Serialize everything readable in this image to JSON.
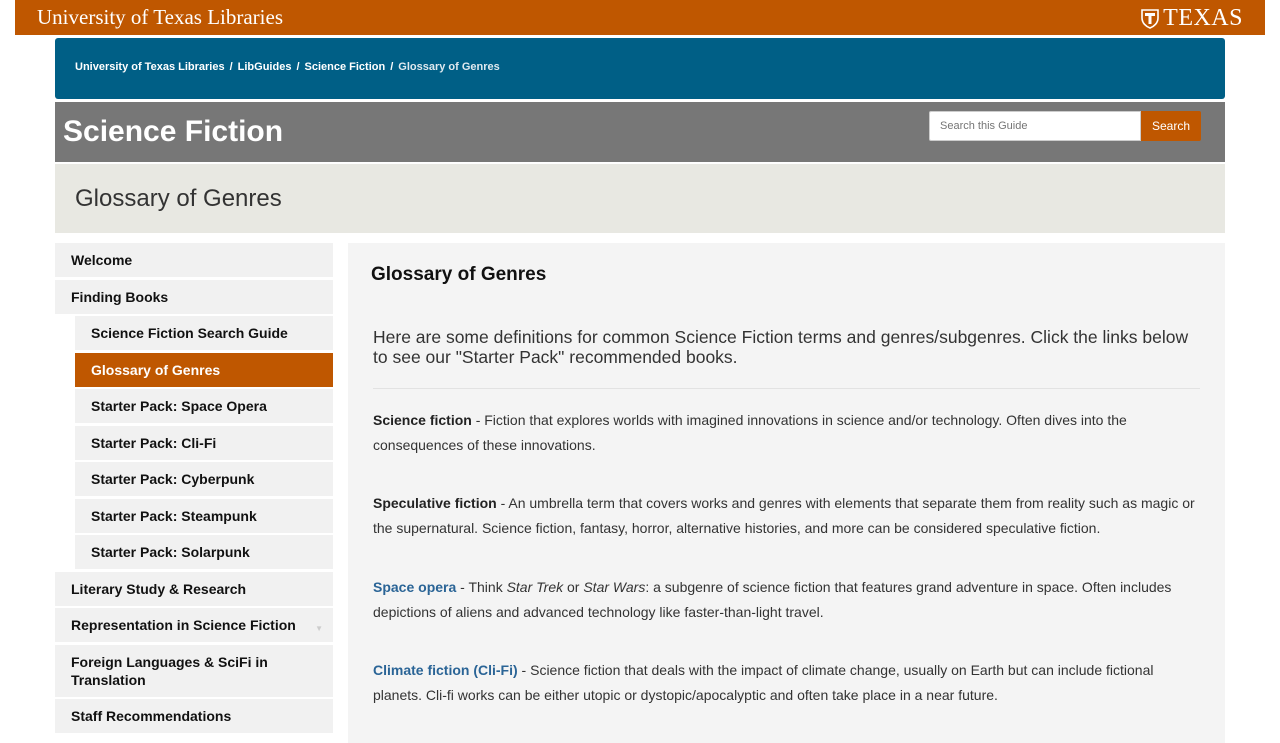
{
  "header": {
    "brand": "University of Texas Libraries",
    "texas": "TEXAS"
  },
  "breadcrumb": {
    "items": [
      "University of Texas Libraries",
      "LibGuides",
      "Science Fiction"
    ],
    "current": "Glossary of Genres",
    "separator": "/"
  },
  "guide": {
    "title": "Science Fiction",
    "search_placeholder": "Search this Guide",
    "search_button": "Search"
  },
  "page": {
    "title": "Glossary of Genres"
  },
  "sidebar": {
    "items": [
      {
        "label": "Welcome"
      },
      {
        "label": "Finding Books"
      },
      {
        "label": "Science Fiction Search Guide"
      },
      {
        "label": "Glossary of Genres"
      },
      {
        "label": "Starter Pack: Space Opera"
      },
      {
        "label": "Starter Pack: Cli-Fi"
      },
      {
        "label": "Starter Pack: Cyberpunk"
      },
      {
        "label": "Starter Pack: Steampunk"
      },
      {
        "label": "Starter Pack: Solarpunk"
      },
      {
        "label": "Literary Study & Research"
      },
      {
        "label": "Representation in Science Fiction"
      },
      {
        "label": "Foreign Languages & SciFi in Translation"
      },
      {
        "label": "Staff Recommendations"
      }
    ]
  },
  "content": {
    "heading": "Glossary of Genres",
    "intro": "Here are some definitions for common Science Fiction terms and genres/subgenres. Click the links below to see our \"Starter Pack\" recommended books.",
    "entries": [
      {
        "term": "Science fiction",
        "text": " - Fiction that explores worlds with imagined innovations in science and/or technology. Often dives into the consequences of these innovations."
      },
      {
        "term": "Speculative fiction",
        "text": " - An umbrella term that covers works and genres with elements that separate them from reality such as magic or the supernatural. Science fiction, fantasy, horror, alternative histories, and more can be considered speculative fiction."
      },
      {
        "term": "Space opera",
        "text_a": " - Think ",
        "em_a": "Star Trek",
        "text_b": " or ",
        "em_b": "Star Wars",
        "text_c": ": a subgenre of science fiction that features grand adventure in space. Often includes depictions of aliens and advanced technology like faster-than-light travel."
      },
      {
        "term": "Climate fiction (Cli-Fi)",
        "text": " - Science fiction that deals with the impact of climate change, usually on Earth but can include fictional planets. Cli-fi works can be either utopic or dystopic/apocalyptic and often take place in a near future."
      }
    ]
  },
  "colors": {
    "burnt_orange": "#bf5700",
    "breadcrumb_blue": "#005f86",
    "guide_gray": "#777777",
    "link_blue": "#2a6496"
  }
}
